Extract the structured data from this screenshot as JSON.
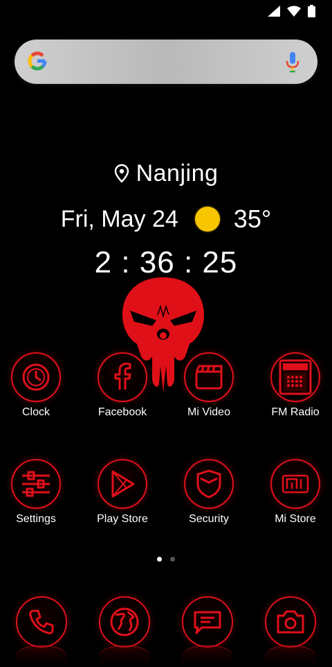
{
  "status_bar": {
    "icons": [
      "signal-icon",
      "wifi-icon",
      "battery-icon"
    ]
  },
  "search": {
    "logo": "google-logo",
    "mic_icon": "mic-icon"
  },
  "weather": {
    "location": "Nanjing",
    "date": "Fri, May 24",
    "condition_icon": "sun-icon",
    "temperature": "35°",
    "time": "2 : 36 : 25"
  },
  "apps_row1": [
    {
      "label": "Clock",
      "icon": "clock-icon"
    },
    {
      "label": "Facebook",
      "icon": "facebook-icon"
    },
    {
      "label": "Mi Video",
      "icon": "clapper-icon"
    },
    {
      "label": "FM Radio",
      "icon": "radio-icon"
    }
  ],
  "apps_row2": [
    {
      "label": "Settings",
      "icon": "sliders-icon"
    },
    {
      "label": "Play Store",
      "icon": "play-store-icon"
    },
    {
      "label": "Security",
      "icon": "shield-icon"
    },
    {
      "label": "Mi Store",
      "icon": "mi-logo-icon"
    }
  ],
  "dock": [
    {
      "icon": "phone-icon"
    },
    {
      "icon": "globe-icon"
    },
    {
      "icon": "message-icon"
    },
    {
      "icon": "camera-icon"
    }
  ],
  "page_indicator": {
    "pages": 2,
    "active": 1
  },
  "colors": {
    "accent": "#e0101a",
    "background": "#000000",
    "sun": "#f7c600"
  }
}
